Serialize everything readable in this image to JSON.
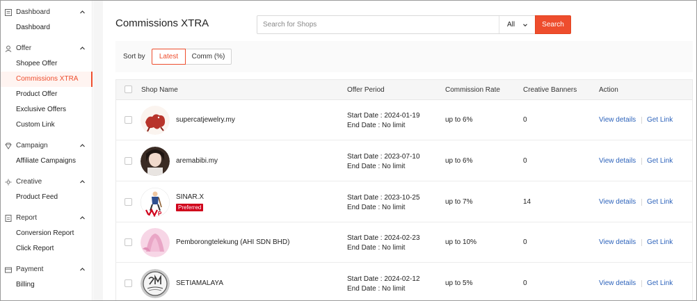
{
  "sidebar": {
    "groups": [
      {
        "label": "Dashboard",
        "icon": "dashboard-icon",
        "items": [
          "Dashboard"
        ]
      },
      {
        "label": "Offer",
        "icon": "offer-icon",
        "items": [
          "Shopee Offer",
          "Commissions XTRA",
          "Product Offer",
          "Exclusive Offers",
          "Custom Link"
        ]
      },
      {
        "label": "Campaign",
        "icon": "campaign-icon",
        "items": [
          "Affiliate Campaigns"
        ]
      },
      {
        "label": "Creative",
        "icon": "creative-icon",
        "items": [
          "Product Feed"
        ]
      },
      {
        "label": "Report",
        "icon": "report-icon",
        "items": [
          "Conversion Report",
          "Click Report"
        ]
      },
      {
        "label": "Payment",
        "icon": "payment-icon",
        "items": [
          "Billing"
        ]
      }
    ],
    "active_item": "Commissions XTRA"
  },
  "header": {
    "title": "Commissions XTRA",
    "search_placeholder": "Search for Shops",
    "search_value": "",
    "scope": "All",
    "search_button": "Search"
  },
  "sort": {
    "label": "Sort by",
    "options": [
      "Latest",
      "Comm (%)"
    ],
    "selected": "Latest"
  },
  "table": {
    "columns": [
      "Shop Name",
      "Offer Period",
      "Commission Rate",
      "Creative Banners",
      "Action"
    ],
    "rows": [
      {
        "shop": "supercatjewelry.my",
        "badge": "",
        "start": "Start Date : 2024-01-19",
        "end": "End Date : No limit",
        "rate": "up to 6%",
        "banners": "0",
        "view": "View details",
        "link": "Get Link"
      },
      {
        "shop": "aremabibi.my",
        "badge": "",
        "start": "Start Date : 2023-07-10",
        "end": "End Date : No limit",
        "rate": "up to 6%",
        "banners": "0",
        "view": "View details",
        "link": "Get Link"
      },
      {
        "shop": "SINAR.X",
        "badge": "Preferred",
        "start": "Start Date : 2023-10-25",
        "end": "End Date : No limit",
        "rate": "up to 7%",
        "banners": "14",
        "view": "View details",
        "link": "Get Link"
      },
      {
        "shop": "Pemborongtelekung (AHI SDN BHD)",
        "badge": "",
        "start": "Start Date : 2024-02-23",
        "end": "End Date : No limit",
        "rate": "up to 10%",
        "banners": "0",
        "view": "View details",
        "link": "Get Link"
      },
      {
        "shop": "SETIAMALAYA",
        "badge": "",
        "start": "Start Date : 2024-02-12",
        "end": "End Date : No limit",
        "rate": "up to 5%",
        "banners": "0",
        "view": "View details",
        "link": "Get Link"
      }
    ]
  },
  "colors": {
    "accent": "#ee4d2d",
    "link": "#2d63bb",
    "badge": "#d0011b"
  }
}
